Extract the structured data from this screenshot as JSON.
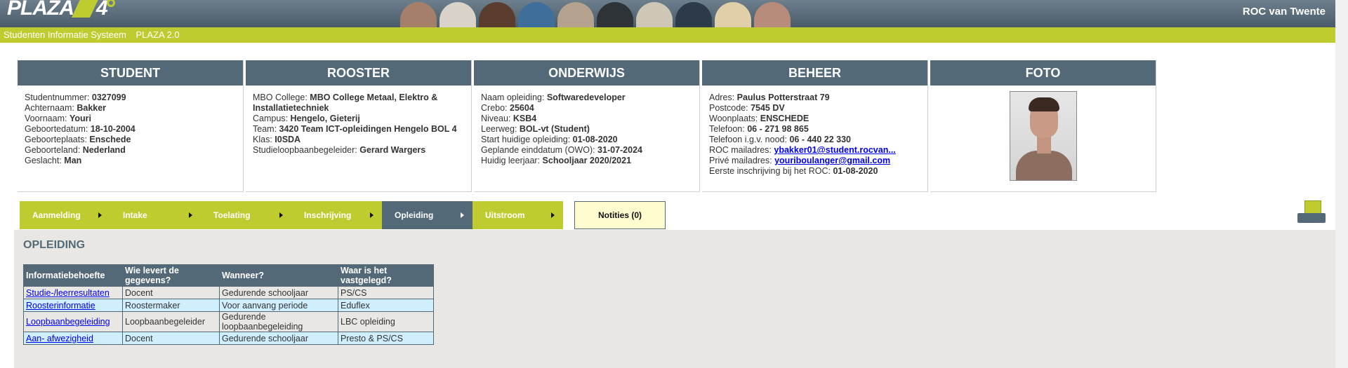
{
  "header": {
    "logo_text": "PLAZA",
    "logo_number": "4",
    "organisation": "ROC van Twente"
  },
  "greenbar": {
    "system": "Studenten Informatie Systeem",
    "version": "PLAZA 2.0"
  },
  "panels": {
    "student": {
      "title": "STUDENT",
      "rows": [
        {
          "label": "Studentnummer:",
          "value": "0327099"
        },
        {
          "label": "Achternaam:",
          "value": "Bakker"
        },
        {
          "label": "Voornaam:",
          "value": "Youri"
        },
        {
          "label": "Geboortedatum:",
          "value": "18-10-2004"
        },
        {
          "label": "Geboorteplaats:",
          "value": "Enschede"
        },
        {
          "label": "Geboorteland:",
          "value": "Nederland"
        },
        {
          "label": "Geslacht:",
          "value": "Man"
        }
      ]
    },
    "rooster": {
      "title": "ROOSTER",
      "rows": [
        {
          "label": "MBO College:",
          "value": "MBO College Metaal, Elektro & Installatietechniek"
        },
        {
          "label": "Campus:",
          "value": "Hengelo, Gieterij"
        },
        {
          "label": "Team:",
          "value": "3420 Team ICT-opleidingen Hengelo BOL 4"
        },
        {
          "label": "Klas:",
          "value": "I0SDA"
        },
        {
          "label": "Studieloopbaanbegeleider:",
          "value": "Gerard Wargers"
        }
      ]
    },
    "onderwijs": {
      "title": "ONDERWIJS",
      "rows": [
        {
          "label": "Naam opleiding:",
          "value": "Softwaredeveloper"
        },
        {
          "label": "Crebo:",
          "value": "25604"
        },
        {
          "label": "Niveau:",
          "value": "KSB4"
        },
        {
          "label": "Leerweg:",
          "value": "BOL-vt (Student)"
        },
        {
          "label": "Start huidige opleiding:",
          "value": "01-08-2020"
        },
        {
          "label": "Geplande einddatum (OWO):",
          "value": "31-07-2024"
        },
        {
          "label": "Huidig leerjaar:",
          "value": "Schooljaar 2020/2021"
        }
      ]
    },
    "beheer": {
      "title": "BEHEER",
      "rows": [
        {
          "label": "Adres:",
          "value": "Paulus Potterstraat 79"
        },
        {
          "label": "Postcode:",
          "value": "7545 DV"
        },
        {
          "label": "Woonplaats:",
          "value": "ENSCHEDE"
        },
        {
          "label": "Telefoon:",
          "value": "06 - 271 98 865"
        },
        {
          "label": "Telefoon i.g.v. nood:",
          "value": "06 - 440 22 330"
        },
        {
          "label": "ROC mailadres:",
          "value": "ybakker01@student.rocvan..."
        },
        {
          "label": "Privé mailadres:",
          "value": "youriboulanger@gmail.com"
        },
        {
          "label": "Eerste inschrijving bij het ROC:",
          "value": "01-08-2020"
        }
      ]
    },
    "foto": {
      "title": "FOTO"
    }
  },
  "tabs": [
    {
      "label": "Aanmelding",
      "active": false
    },
    {
      "label": "Intake",
      "active": false
    },
    {
      "label": "Toelating",
      "active": false
    },
    {
      "label": "Inschrijving",
      "active": false
    },
    {
      "label": "Opleiding",
      "active": true
    },
    {
      "label": "Uitstroom",
      "active": false
    }
  ],
  "notes_button": "Notities (0)",
  "content": {
    "title": "OPLEIDING",
    "table": {
      "headers": [
        "Informatiebehoefte",
        "Wie levert de gegevens?",
        "Wanneer?",
        "Waar is het vastgelegd?"
      ],
      "rows": [
        [
          "Studie-/leerresultaten",
          "Docent",
          "Gedurende schooljaar",
          "PS/CS"
        ],
        [
          "Roosterinformatie",
          "Roostermaker",
          "Voor aanvang periode",
          "Eduflex"
        ],
        [
          "Loopbaanbegeleiding",
          "Loopbaanbegeleider",
          "Gedurende loopbaanbegeleiding",
          "LBC opleiding"
        ],
        [
          "Aan- afwezigheid",
          "Docent",
          "Gedurende schooljaar",
          "Presto & PS/CS"
        ]
      ]
    }
  },
  "colors": {
    "brand_green": "#bfcc2f",
    "panel_header": "#546978",
    "content_bg": "#e9e7e3",
    "row_highlight": "#cfeefe",
    "notes_bg": "#fffdd0"
  }
}
